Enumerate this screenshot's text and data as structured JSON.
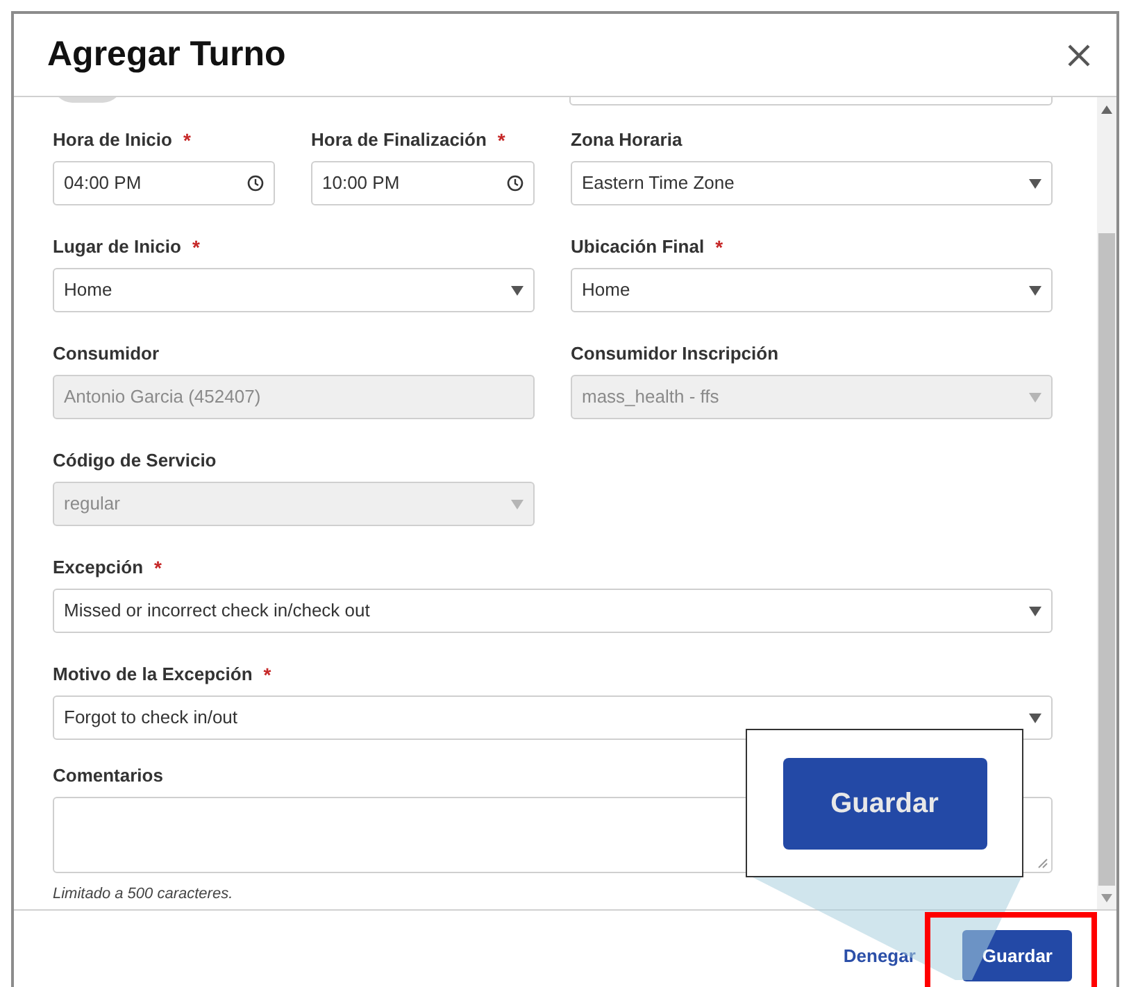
{
  "dialog": {
    "title": "Agregar Turno"
  },
  "rows": [
    [
      {
        "label": "Hora de Inicio",
        "required_mark": "*",
        "kind": "time",
        "value": "04:00 PM",
        "disabled": false
      },
      {
        "label": "Hora de Finalización",
        "required_mark": "*",
        "kind": "time",
        "value": "10:00 PM",
        "disabled": false
      },
      {
        "label": "Zona Horaria",
        "kind": "select",
        "value": "Eastern Time Zone",
        "disabled": false
      }
    ],
    [
      {
        "label": "Lugar de Inicio",
        "required_mark": "*",
        "kind": "select",
        "value": "Home",
        "disabled": false
      },
      {
        "label": "Ubicación Final",
        "required_mark": "*",
        "kind": "select",
        "value": "Home",
        "disabled": false
      }
    ],
    [
      {
        "label": "Consumidor",
        "kind": "text",
        "value": "Antonio Garcia (452407)",
        "disabled": true
      },
      {
        "label": "Consumidor Inscripción",
        "kind": "select",
        "value": "mass_health - ffs",
        "disabled": true
      }
    ],
    [
      {
        "label": "Código de Servicio",
        "kind": "select",
        "value": "regular",
        "disabled": true
      }
    ],
    [
      {
        "label": "Excepción",
        "required_mark": "*",
        "kind": "select",
        "value": "Missed or incorrect check in/check out",
        "disabled": false
      }
    ],
    [
      {
        "label": "Motivo de la Excepción",
        "required_mark": "*",
        "kind": "select",
        "value": "Forgot to check in/out",
        "disabled": false
      }
    ]
  ],
  "comments": {
    "label": "Comentarios",
    "hint": "Limitado a 500 caracteres."
  },
  "footer": {
    "deny": "Denegar",
    "save": "Guardar"
  },
  "callout": {
    "label": "Guardar"
  }
}
